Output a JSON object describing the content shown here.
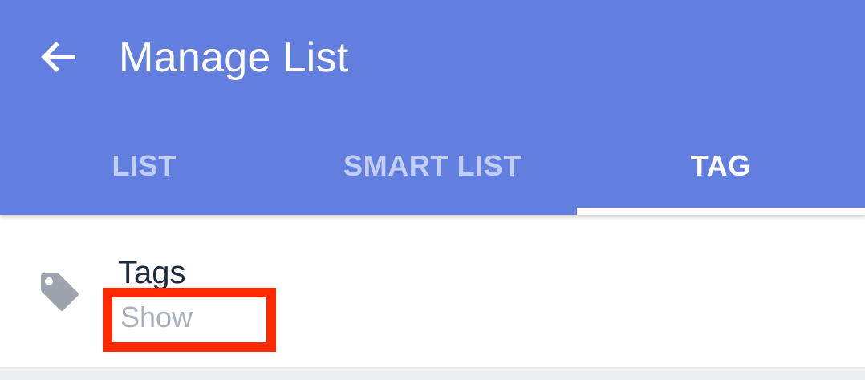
{
  "header": {
    "title": "Manage List",
    "back_icon": "arrow-left-icon",
    "background_color": "#627fe0"
  },
  "tabs": [
    {
      "label": "LIST",
      "active": false
    },
    {
      "label": "SMART LIST",
      "active": false
    },
    {
      "label": "TAG",
      "active": true
    }
  ],
  "list": {
    "items": [
      {
        "icon": "tag-icon",
        "title": "Tags",
        "subtitle": "Show"
      }
    ]
  },
  "colors": {
    "title_text": "#1b2a3e",
    "subtitle_text": "#a9b0bc",
    "highlight_border": "#ff2a00"
  }
}
